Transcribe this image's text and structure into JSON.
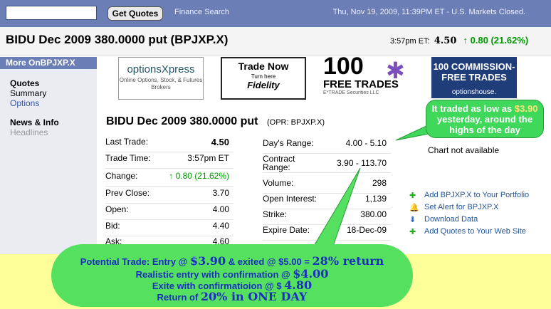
{
  "topbar": {
    "button": "Get Quotes",
    "finance_search": "Finance Search",
    "date_line": "Thu, Nov 19, 2009, 11:39PM ET - U.S. Markets Closed."
  },
  "header": {
    "title": "BIDU Dec 2009 380.0000 put (BPJXP.X)",
    "time_label": "3:57pm ET:",
    "price": "4.50",
    "change": "0.80 (21.62%)"
  },
  "leftnav": {
    "head": "More OnBPJXP.X",
    "quotes": "Quotes",
    "summary": "Summary",
    "options": "Options",
    "news": "News & Info",
    "headlines": "Headlines"
  },
  "ads": {
    "ad1_title": "optionsXpress",
    "ad1_sub": "Online Options, Stock, & Futures Brokers",
    "ad2_title": "Trade Now",
    "ad2_sub": "Turn here",
    "ad2_brand": "Fidelity",
    "ad3_num": "100",
    "ad3_text": "FREE TRADES",
    "ad3_sub": "E*TRADE Securities LLC",
    "ad4_text": "100 COMMISSION-FREE TRADES",
    "ad4_brand": "optionshouse."
  },
  "quote": {
    "title": "BIDU Dec 2009 380.0000 put",
    "symbol": "(OPR: BPJXP.X)",
    "left": [
      {
        "label": "Last Trade:",
        "value": "4.50"
      },
      {
        "label": "Trade Time:",
        "value": "3:57pm ET"
      },
      {
        "label": "Change:",
        "value": "0.80 (21.62%)"
      },
      {
        "label": "Prev Close:",
        "value": "3.70"
      },
      {
        "label": "Open:",
        "value": "4.00"
      },
      {
        "label": "Bid:",
        "value": "4.40"
      },
      {
        "label": "Ask:",
        "value": "4.60"
      }
    ],
    "right": [
      {
        "label": "Day's Range:",
        "value": "4.00 - 5.10"
      },
      {
        "label": "Contract Range:",
        "value": "3.90 - 113.70"
      },
      {
        "label": "Volume:",
        "value": "298"
      },
      {
        "label": "Open Interest:",
        "value": "1,139"
      },
      {
        "label": "Strike:",
        "value": "380.00"
      },
      {
        "label": "Expire Date:",
        "value": "18-Dec-09"
      }
    ]
  },
  "chart_na": "Chart not available",
  "links": [
    "Add BPJXP.X to Your Portfolio",
    "Set Alert for BPJXP.X",
    "Download Data",
    "Add Quotes to Your Web Site"
  ],
  "callout": {
    "l1a": "It traded as low as ",
    "l1b": "$3.90",
    "l2": "yesterday, around the",
    "l3": "highs of the day"
  },
  "bubble": {
    "l1a": "Potential Trade: Entry @ ",
    "l1b": "$3.90",
    "l1c": " & exited @ ",
    "l1d": "$5.00",
    "l1e": " = ",
    "l1f": "28% return",
    "l2a": "Realistic entry with confirmation @ ",
    "l2b": "$4.00",
    "l3a": "Exite with confirmatioion @ $ ",
    "l3b": "4.80",
    "l4a": "Return of ",
    "l4b": "20% in ONE DAY"
  }
}
